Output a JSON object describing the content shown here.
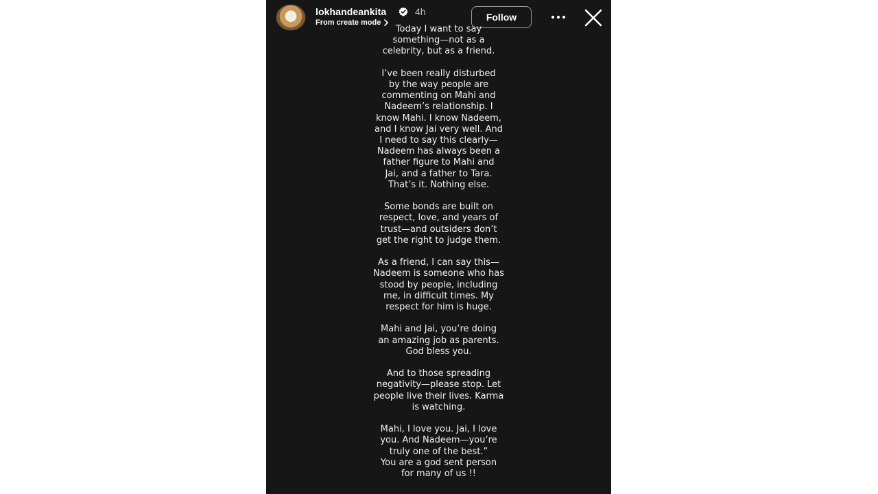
{
  "story": {
    "username": "lokhandeankita",
    "verified_icon": "verified-badge-icon",
    "time": "4h",
    "subtitle": "From create mode",
    "follow_label": "Follow",
    "more_icon": "more-icon",
    "close_icon": "close-icon"
  },
  "content": {
    "paragraphs": [
      {
        "lines": [
          "Today I want to say",
          "something—not as a",
          "celebrity, but as a friend."
        ]
      },
      {
        "lines": [
          "I’ve been really disturbed",
          "by the way people are",
          "commenting on Mahi and",
          "Nadeem’s relationship. I",
          "know Mahi. I know Nadeem,",
          "and I know Jai very well. And",
          "I need to say this clearly—",
          "Nadeem has always been a",
          "father figure to Mahi and",
          "Jai, and a father to Tara.",
          "That’s it. Nothing else."
        ]
      },
      {
        "lines": [
          "Some bonds are built on",
          "respect, love, and years of",
          "trust—and outsiders don’t",
          "get the right to judge them."
        ]
      },
      {
        "lines": [
          "As a friend, I can say this—",
          "Nadeem is someone who has",
          "stood by people, including",
          "me, in difficult times. My",
          "respect for him is huge."
        ]
      },
      {
        "lines": [
          "Mahi and Jai, you’re doing",
          "an amazing job as parents.",
          "God bless you."
        ]
      },
      {
        "lines": [
          "And to those spreading",
          "negativity—please stop. Let",
          "people live their lives. Karma",
          "is watching."
        ]
      },
      {
        "lines": [
          "Mahi, I love you. Jai, I love",
          "you. And Nadeem—you’re",
          "truly one of the best.”",
          "You are a god sent person",
          "for many of us !!"
        ]
      }
    ]
  }
}
